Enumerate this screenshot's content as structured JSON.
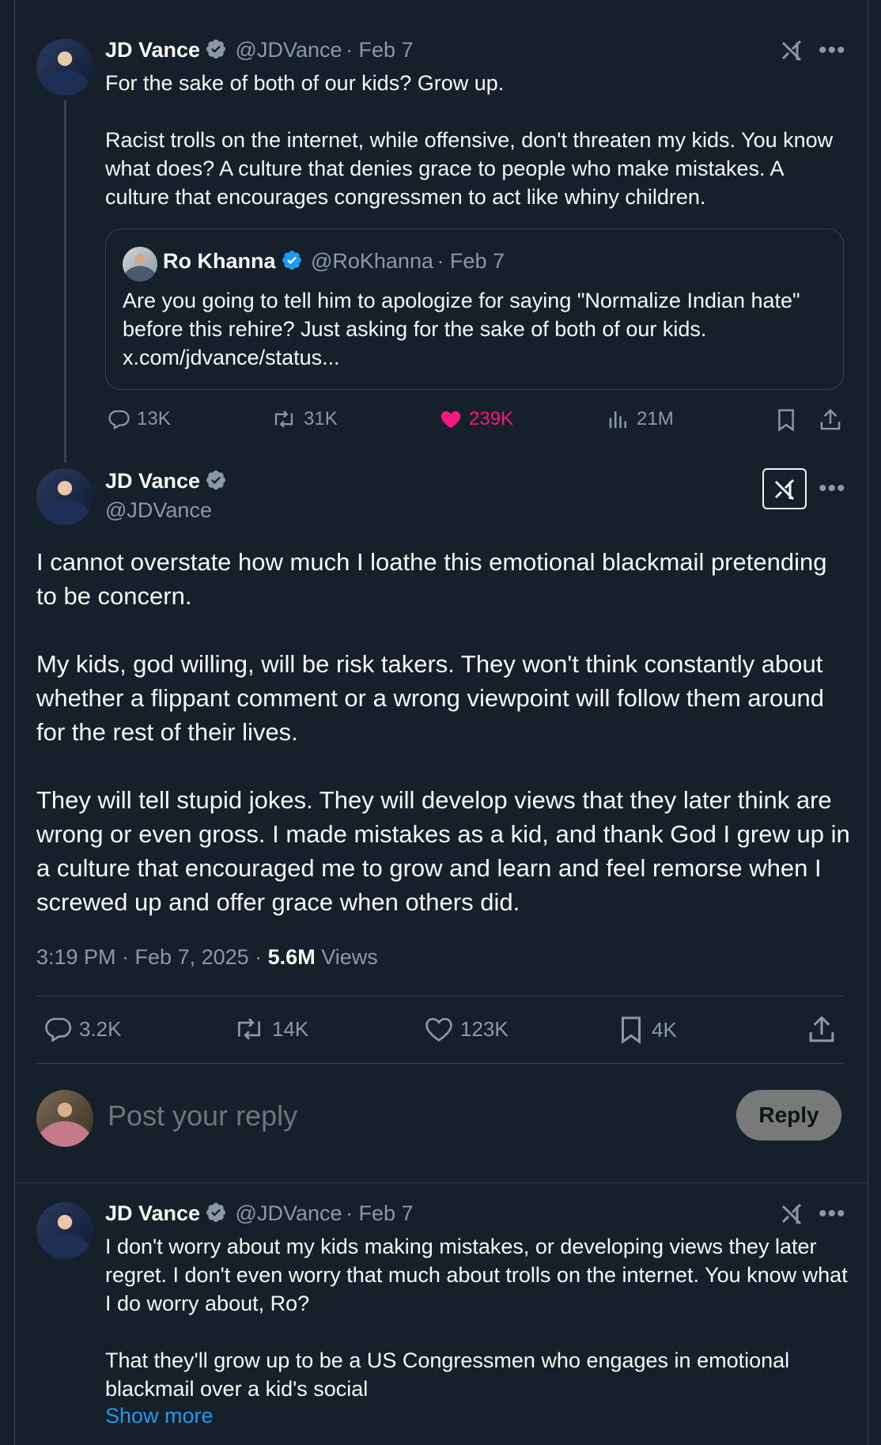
{
  "tweet1": {
    "name": "JD Vance",
    "handle": "@JDVance",
    "date": "· Feb 7",
    "text": "For the sake of both of our kids? Grow up.\n\nRacist trolls on the internet, while offensive, don't threaten my kids. You know what does? A culture that denies grace to people who make mistakes. A culture that encourages congressmen to act like whiny children.",
    "quote": {
      "name": "Ro Khanna",
      "handle": "@RoKhanna",
      "date": "· Feb 7",
      "text": "Are you going to tell him to apologize for saying \"Normalize Indian hate\" before this rehire? Just asking for the sake of both of our kids.\nx.com/jdvance/status..."
    },
    "stats": {
      "replies": "13K",
      "reposts": "31K",
      "likes": "239K",
      "views": "21M"
    }
  },
  "main_tweet": {
    "name": "JD Vance",
    "handle": "@JDVance",
    "text": "I cannot overstate how much I loathe this emotional blackmail pretending to be concern.\n\nMy kids, god willing, will be risk takers. They won't think constantly about whether a flippant comment or a wrong viewpoint will follow them around for the rest of their lives.\n\nThey will tell stupid jokes. They will develop views that they later think are wrong or even gross. I made mistakes as a kid, and thank God I grew up in a culture that encouraged me to grow and learn and feel remorse when I screwed up and offer grace when others did.",
    "timestamp": "3:19 PM · Feb 7, 2025 · ",
    "views_count": "5.6M",
    "views_label": " Views",
    "stats": {
      "replies": "3.2K",
      "reposts": "14K",
      "likes": "123K",
      "bookmarks": "4K"
    }
  },
  "reply_box": {
    "placeholder": "Post your reply",
    "button": "Reply"
  },
  "tweet3": {
    "name": "JD Vance",
    "handle": "@JDVance",
    "date": "· Feb 7",
    "text": "I don't worry about my kids making mistakes, or developing views they later regret. I don't even worry that much about trolls on the internet. You know what I do worry about, Ro?\n\nThat they'll grow up to be a US Congressmen who engages in emotional blackmail over a kid's social",
    "show_more": "Show more"
  },
  "colors": {
    "background": "#15202b",
    "accent": "#1d9bf0",
    "like": "#f91880",
    "muted": "#8b98a5",
    "border": "#38444d"
  },
  "icons": [
    "verified-badge-icon",
    "grok-icon",
    "more-icon",
    "reply-icon",
    "repost-icon",
    "like-icon",
    "views-icon",
    "bookmark-icon",
    "share-icon"
  ]
}
